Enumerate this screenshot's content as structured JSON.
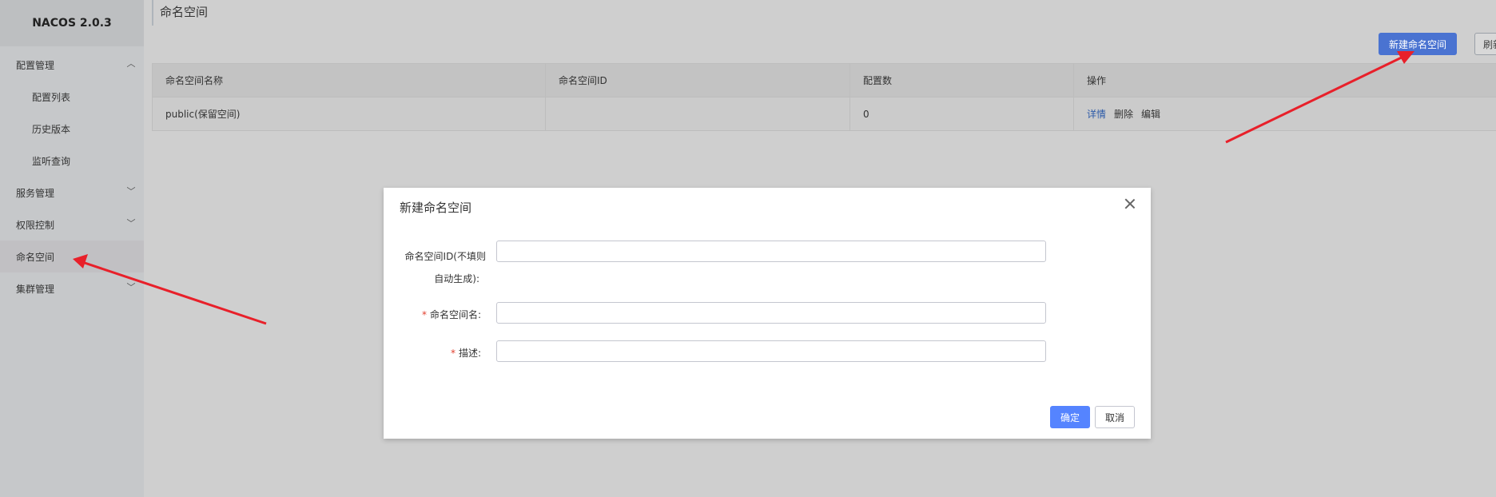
{
  "sidebar": {
    "logo": "NACOS 2.0.3",
    "items": [
      {
        "label": "配置管理",
        "chevron": "up"
      },
      {
        "label": "配置列表"
      },
      {
        "label": "历史版本"
      },
      {
        "label": "监听查询"
      },
      {
        "label": "服务管理",
        "chevron": "down"
      },
      {
        "label": "权限控制",
        "chevron": "down"
      },
      {
        "label": "命名空间",
        "active": true
      },
      {
        "label": "集群管理",
        "chevron": "down"
      }
    ]
  },
  "header": {
    "title": "命名空间"
  },
  "toolbar": {
    "new_label": "新建命名空间",
    "refresh_label": "刷新"
  },
  "table": {
    "columns": [
      "命名空间名称",
      "命名空间ID",
      "配置数",
      "操作"
    ],
    "rows": [
      {
        "name": "public(保留空间)",
        "id": "",
        "count": "0",
        "ops": [
          "详情",
          "删除",
          "编辑"
        ]
      }
    ]
  },
  "modal": {
    "title": "新建命名空间",
    "fields": {
      "id_label_line1": "命名空间ID(不填则",
      "id_label_line2": "自动生成):",
      "name_label": "命名空间名:",
      "desc_label": "描述:",
      "required_mark": "*"
    },
    "ok_label": "确定",
    "cancel_label": "取消"
  },
  "colors": {
    "primary": "#4a73d1",
    "ok": "#5584ff",
    "annotation_arrow": "#e8202a"
  }
}
